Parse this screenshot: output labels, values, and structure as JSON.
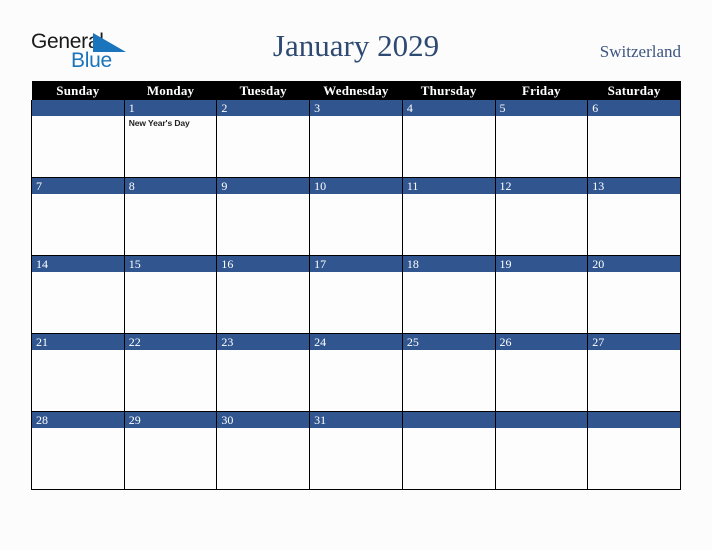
{
  "brand": {
    "line1": "General",
    "line2": "Blue",
    "mark": "triangle-flag",
    "color_dark": "#1a1a1a",
    "color_blue": "#1b75bc"
  },
  "header": {
    "title": "January 2029",
    "country": "Switzerland",
    "title_color": "#2e4a72"
  },
  "calendar": {
    "header_bg": "#000000",
    "band_color": "#31568f",
    "weekdays": [
      "Sunday",
      "Monday",
      "Tuesday",
      "Wednesday",
      "Thursday",
      "Friday",
      "Saturday"
    ],
    "weeks": [
      [
        {
          "day": "",
          "events": []
        },
        {
          "day": "1",
          "events": [
            "New Year's Day"
          ]
        },
        {
          "day": "2",
          "events": []
        },
        {
          "day": "3",
          "events": []
        },
        {
          "day": "4",
          "events": []
        },
        {
          "day": "5",
          "events": []
        },
        {
          "day": "6",
          "events": []
        }
      ],
      [
        {
          "day": "7",
          "events": []
        },
        {
          "day": "8",
          "events": []
        },
        {
          "day": "9",
          "events": []
        },
        {
          "day": "10",
          "events": []
        },
        {
          "day": "11",
          "events": []
        },
        {
          "day": "12",
          "events": []
        },
        {
          "day": "13",
          "events": []
        }
      ],
      [
        {
          "day": "14",
          "events": []
        },
        {
          "day": "15",
          "events": []
        },
        {
          "day": "16",
          "events": []
        },
        {
          "day": "17",
          "events": []
        },
        {
          "day": "18",
          "events": []
        },
        {
          "day": "19",
          "events": []
        },
        {
          "day": "20",
          "events": []
        }
      ],
      [
        {
          "day": "21",
          "events": []
        },
        {
          "day": "22",
          "events": []
        },
        {
          "day": "23",
          "events": []
        },
        {
          "day": "24",
          "events": []
        },
        {
          "day": "25",
          "events": []
        },
        {
          "day": "26",
          "events": []
        },
        {
          "day": "27",
          "events": []
        }
      ],
      [
        {
          "day": "28",
          "events": []
        },
        {
          "day": "29",
          "events": []
        },
        {
          "day": "30",
          "events": []
        },
        {
          "day": "31",
          "events": []
        },
        {
          "day": "",
          "events": []
        },
        {
          "day": "",
          "events": []
        },
        {
          "day": "",
          "events": []
        }
      ]
    ]
  }
}
